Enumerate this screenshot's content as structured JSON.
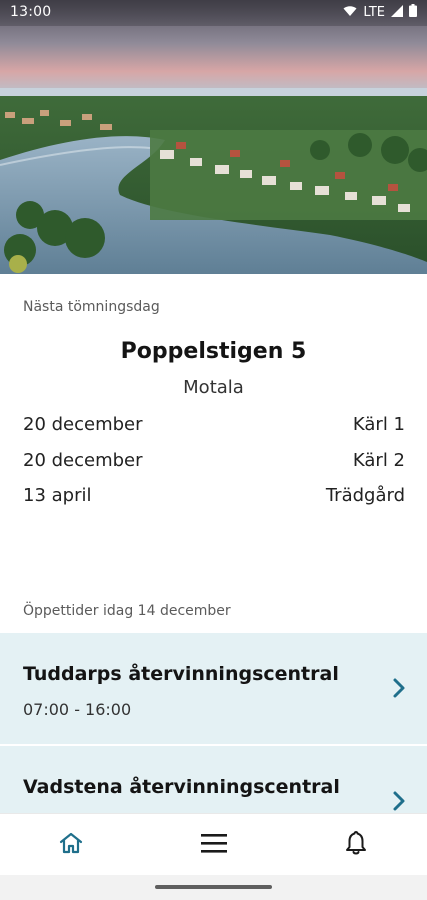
{
  "status_bar": {
    "time": "13:00",
    "network": "LTE",
    "icons": [
      "wifi-icon",
      "signal-icon",
      "battery-icon"
    ]
  },
  "hero": {
    "image": "scenic-lake-town-aerial"
  },
  "collection": {
    "label": "Nästa tömningsdag",
    "address": "Poppelstigen 5",
    "city": "Motala",
    "rows": [
      {
        "date": "20 december",
        "bin": "Kärl 1"
      },
      {
        "date": "20 december",
        "bin": "Kärl 2"
      },
      {
        "date": "13 april",
        "bin": "Trädgård"
      }
    ]
  },
  "opening": {
    "label": "Öppettider idag 14 december",
    "centers": [
      {
        "name": "Tuddarps återvinningscentral",
        "hours": "07:00 - 16:00"
      },
      {
        "name": "Vadstena återvinningscentral",
        "hours": ""
      }
    ]
  },
  "bottom_nav": {
    "items": [
      {
        "name": "home",
        "icon": "home-icon"
      },
      {
        "name": "menu",
        "icon": "menu-icon"
      },
      {
        "name": "notifications",
        "icon": "bell-icon"
      }
    ]
  },
  "colors": {
    "accent": "#1f6f8b",
    "card_bg": "#e4f1f4"
  }
}
